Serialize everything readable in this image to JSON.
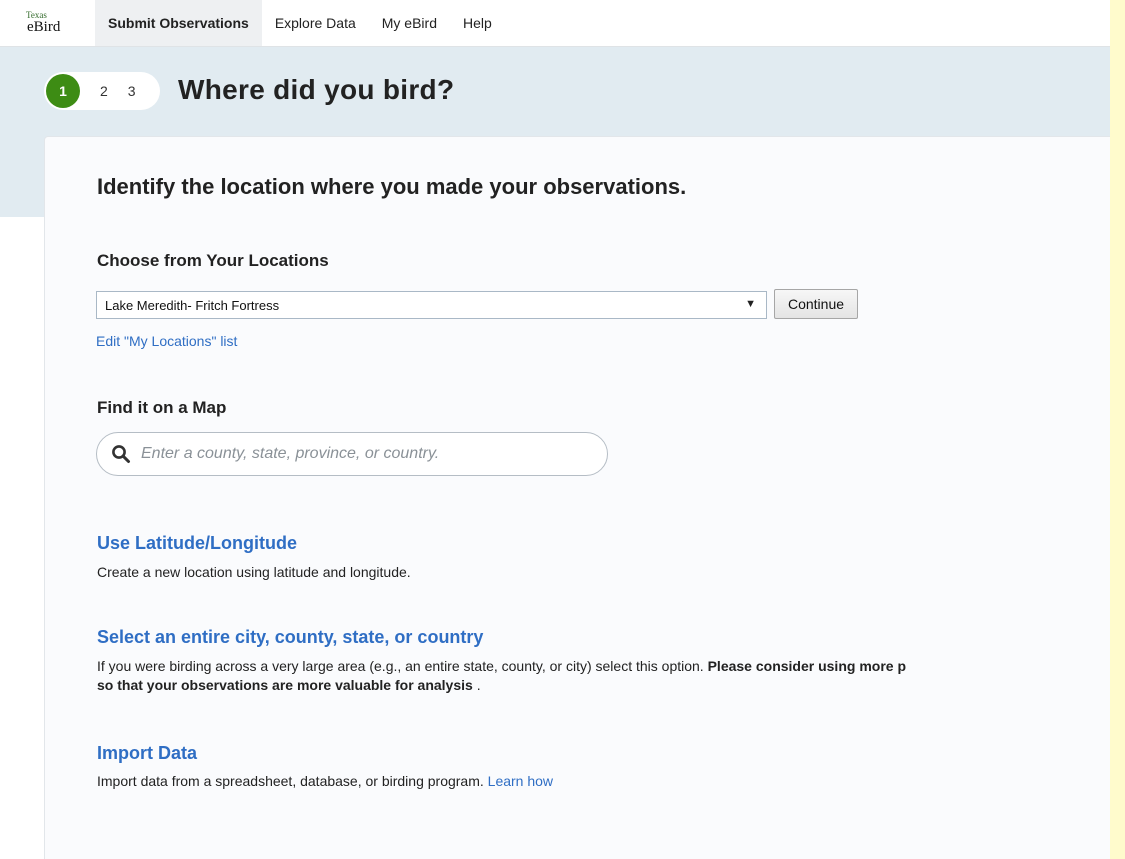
{
  "nav": {
    "logo_top": "Texas",
    "logo_bottom": "eBird",
    "items": [
      {
        "label": "Submit Observations",
        "active": true
      },
      {
        "label": "Explore Data",
        "active": false
      },
      {
        "label": "My eBird",
        "active": false
      },
      {
        "label": "Help",
        "active": false
      }
    ]
  },
  "steps": {
    "current": "1",
    "others": [
      "2",
      "3"
    ]
  },
  "page_title": "Where did you bird?",
  "identify_heading": "Identify the location where you made your observations.",
  "choose": {
    "heading": "Choose from Your Locations",
    "selected_location": "Lake Meredith- Fritch Fortress",
    "continue_label": "Continue",
    "edit_link": "Edit \"My Locations\" list"
  },
  "map": {
    "heading": "Find it on a Map",
    "search_placeholder": "Enter a county, state, province, or country."
  },
  "latlong": {
    "title": "Use Latitude/Longitude",
    "desc": "Create a new location using latitude and longitude."
  },
  "entire": {
    "title": "Select an entire city, county, state, or country",
    "desc_plain": "If you were birding across a very large area (e.g., an entire state, county, or city) select this option. ",
    "desc_bold1": "Please consider using more p",
    "desc_bold2": "so that your observations are more valuable for analysis",
    "desc_end": " ."
  },
  "import": {
    "title": "Import Data",
    "desc": "Import data from a spreadsheet, database, or birding program. ",
    "learn_link": "Learn how"
  },
  "colors": {
    "accent_green": "#3d8c14",
    "link_blue": "#2f6ec4",
    "header_band": "#e1ebf1",
    "outer_yellow": "#fffbcc"
  }
}
